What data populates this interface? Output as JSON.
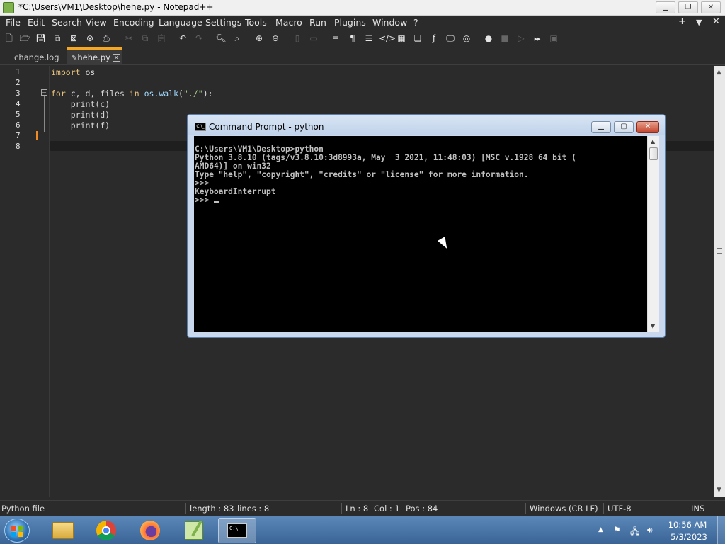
{
  "window": {
    "title": "*C:\\Users\\VM1\\Desktop\\hehe.py - Notepad++"
  },
  "menu": [
    "File",
    "Edit",
    "Search",
    "View",
    "Encoding",
    "Language",
    "Settings",
    "Tools",
    "Macro",
    "Run",
    "Plugins",
    "Window",
    "?"
  ],
  "menu_right": {
    "plus": "+",
    "down": "▼",
    "close": "✕"
  },
  "tabs": [
    {
      "label": "change.log",
      "active": false
    },
    {
      "label": "hehe.py",
      "active": true
    }
  ],
  "editor": {
    "line_numbers": [
      "1",
      "2",
      "3",
      "4",
      "5",
      "6",
      "7",
      "8"
    ],
    "lines": [
      {
        "kw": "import",
        "rest": " os"
      },
      {
        "text": ""
      },
      {
        "kw": "for",
        "pre": " c, d, files ",
        "kw2": "in",
        "mod": " os.walk",
        "paren1": "(",
        "str": "\"./\"",
        "paren2": "):"
      },
      {
        "text": "    print(c)"
      },
      {
        "text": "    print(d)"
      },
      {
        "text": "    print(f)"
      },
      {
        "text": ""
      },
      {
        "text": ""
      }
    ]
  },
  "status": {
    "file_type": "Python file",
    "length": "length : 83",
    "lines": "lines : 8",
    "ln": "Ln : 8",
    "col": "Col : 1",
    "pos": "Pos : 84",
    "eol": "Windows (CR LF)",
    "encoding": "UTF-8",
    "mode": "INS"
  },
  "cmd": {
    "title": "Command Prompt - python",
    "icon_text": "C:\\_",
    "lines": [
      "C:\\Users\\VM1\\Desktop>python",
      "Python 3.8.10 (tags/v3.8.10:3d8993a, May  3 2021, 11:48:03) [MSC v.1928 64 bit (",
      "AMD64)] on win32",
      "Type \"help\", \"copyright\", \"credits\" or \"license\" for more information.",
      ">>>",
      "KeyboardInterrupt",
      ">>> "
    ]
  },
  "taskbar": {
    "time": "10:56 AM",
    "date": "5/3/2023",
    "apps": [
      "windows-explorer",
      "chrome",
      "firefox",
      "notepad-plus-plus",
      "command-prompt"
    ],
    "cmd_icon_text": "C:\\_"
  },
  "colors": {
    "accent_tab": "#f5a623",
    "change_bar": "#f08a24",
    "keyword": "#e5c07b",
    "string": "#a8d08d"
  }
}
